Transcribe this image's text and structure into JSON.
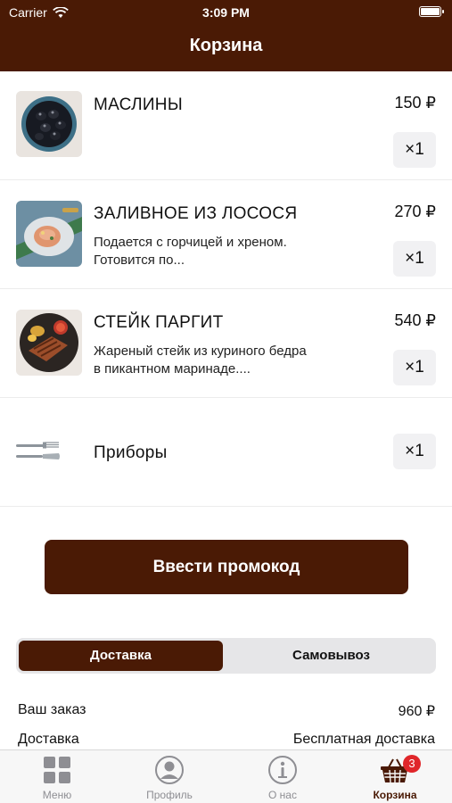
{
  "status": {
    "carrier": "Carrier",
    "time": "3:09 PM"
  },
  "header": {
    "title": "Корзина"
  },
  "items": [
    {
      "name": "МАСЛИНЫ",
      "description": "",
      "price": "150 ₽",
      "qty": "×1"
    },
    {
      "name": "ЗАЛИВНОЕ ИЗ ЛОСОСЯ",
      "description": "Подается с горчицей и хреном. Готовится по...",
      "price": "270 ₽",
      "qty": "×1"
    },
    {
      "name": "СТЕЙК ПАРГИТ",
      "description": "Жареный стейк из куриного бедра в пикантном маринаде....",
      "price": "540 ₽",
      "qty": "×1"
    },
    {
      "name": "Приборы",
      "description": "",
      "price": "",
      "qty": "×1"
    }
  ],
  "promo_button": "Ввести промокод",
  "delivery_toggle": {
    "options": [
      "Доставка",
      "Самовывоз"
    ],
    "selected": "Доставка"
  },
  "summary": {
    "order_label": "Ваш заказ",
    "order_value": "960 ₽",
    "delivery_label": "Доставка",
    "delivery_value": "Бесплатная доставка"
  },
  "tabbar": {
    "tabs": [
      {
        "label": "Меню",
        "icon": "grid-icon"
      },
      {
        "label": "Профиль",
        "icon": "profile-icon"
      },
      {
        "label": "О нас",
        "icon": "info-icon"
      },
      {
        "label": "Корзина",
        "icon": "basket-icon",
        "badge": "3"
      }
    ],
    "active": "Корзина"
  },
  "colors": {
    "brand": "#4a1a05",
    "badge": "#e0262a",
    "inactive": "#8e8e93"
  }
}
